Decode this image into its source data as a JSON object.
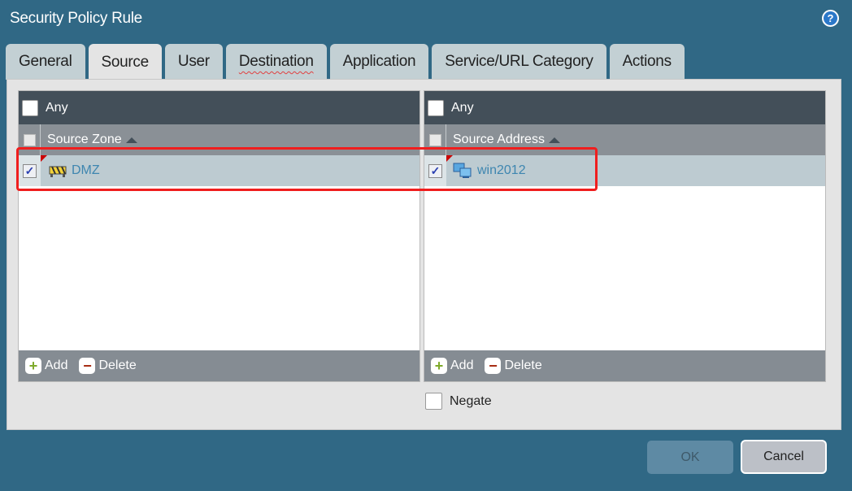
{
  "dialog": {
    "title": "Security Policy Rule",
    "help_icon": "?"
  },
  "tabs": [
    {
      "label": "General"
    },
    {
      "label": "Source",
      "active": true
    },
    {
      "label": "User"
    },
    {
      "label": "Destination"
    },
    {
      "label": "Application"
    },
    {
      "label": "Service/URL Category"
    },
    {
      "label": "Actions"
    }
  ],
  "source_zone": {
    "any_label": "Any",
    "any_checked": false,
    "column": "Source Zone",
    "rows": [
      {
        "value": "DMZ",
        "checked": true,
        "icon": "zone-icon"
      }
    ],
    "add": "Add",
    "delete": "Delete"
  },
  "source_address": {
    "any_label": "Any",
    "any_checked": false,
    "column": "Source Address",
    "rows": [
      {
        "value": "win2012",
        "checked": true,
        "icon": "address-object-icon"
      }
    ],
    "add": "Add",
    "delete": "Delete"
  },
  "negate": {
    "label": "Negate",
    "checked": false
  },
  "buttons": {
    "ok": "OK",
    "cancel": "Cancel"
  },
  "colors": {
    "background": "#306885",
    "highlight": "#f01e1e",
    "link": "#3e86b0"
  }
}
